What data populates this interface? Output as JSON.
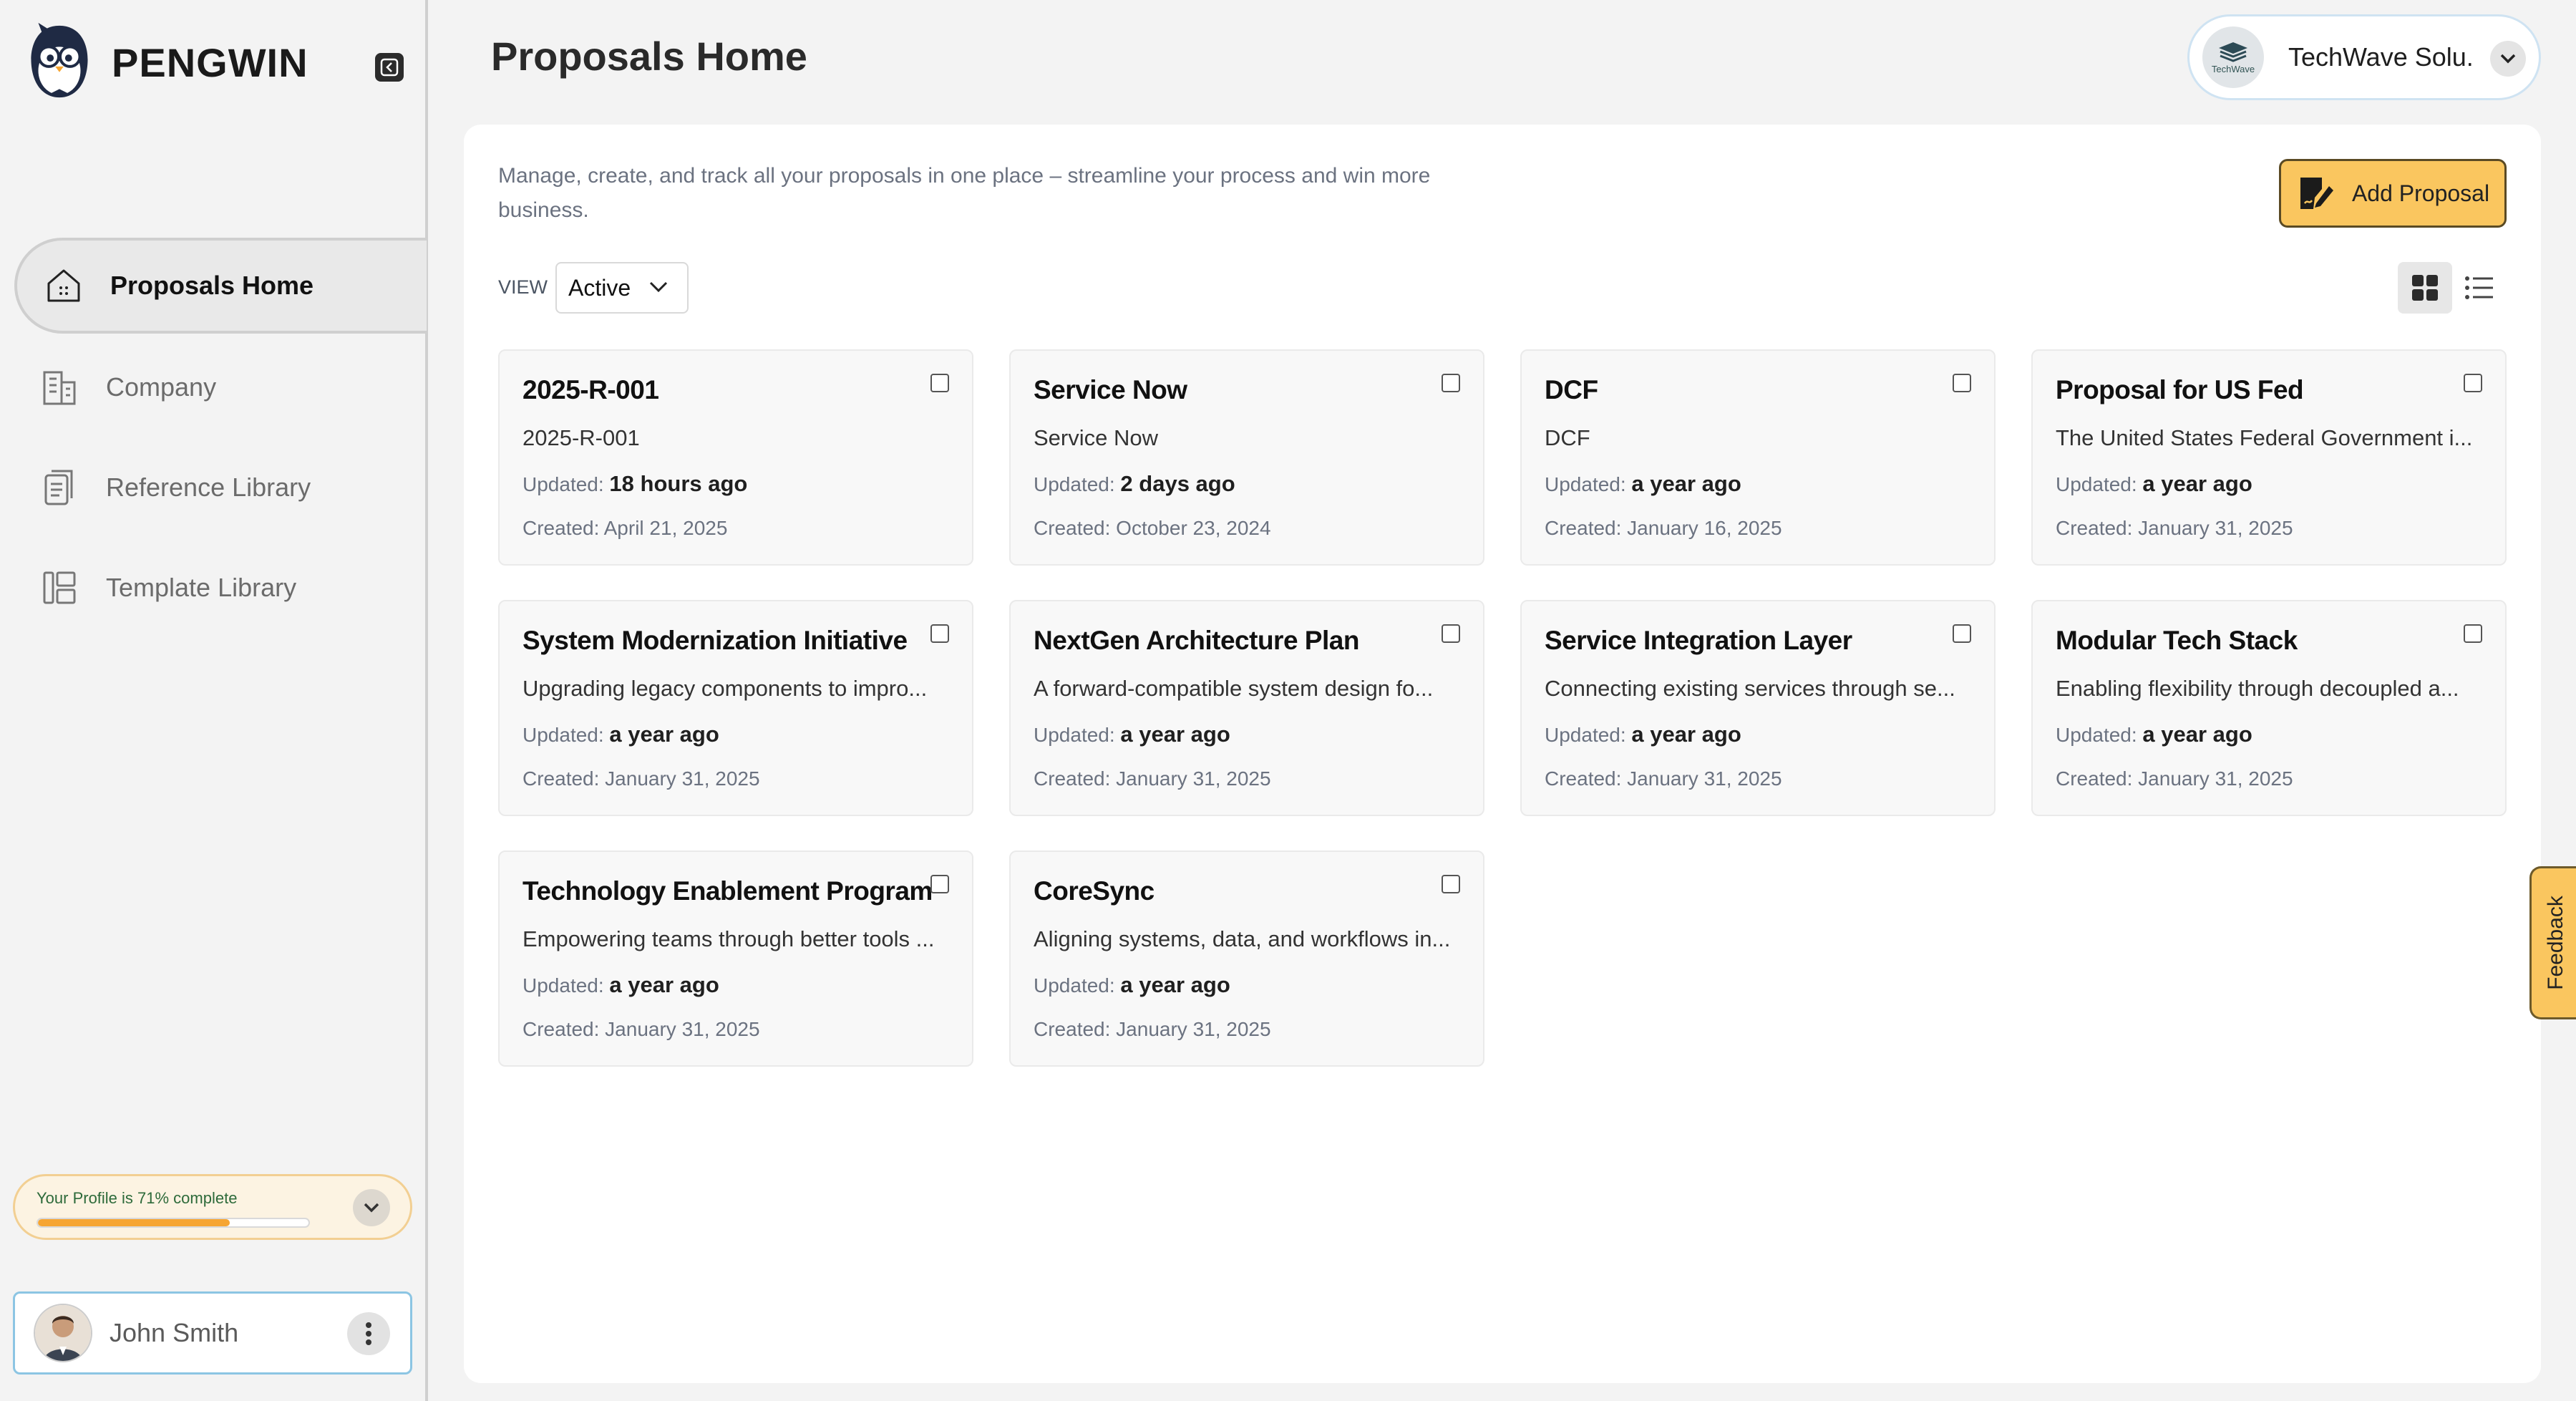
{
  "app": {
    "brand": "PENGWIN"
  },
  "sidebar": {
    "items": [
      {
        "label": "Proposals Home",
        "icon": "home-icon",
        "active": true
      },
      {
        "label": "Company",
        "icon": "building-icon",
        "active": false
      },
      {
        "label": "Reference Library",
        "icon": "documents-icon",
        "active": false
      },
      {
        "label": "Template Library",
        "icon": "template-icon",
        "active": false
      }
    ],
    "profile": {
      "text": "Your Profile is 71% complete",
      "percent": 71
    },
    "user": {
      "name": "John Smith"
    }
  },
  "header": {
    "title": "Proposals Home",
    "org": {
      "name": "TechWave Solu...",
      "logo_text": "TechWave"
    }
  },
  "main": {
    "intro": "Manage, create, and track all your proposals in one place – streamline your process and win more business.",
    "add_button": "Add Proposal",
    "view_label": "VIEW",
    "view_value": "Active",
    "layout_mode": "grid"
  },
  "cards": [
    {
      "title": "2025-R-001",
      "desc": "2025-R-001",
      "updated_label": "Updated:",
      "updated": "18 hours ago",
      "created": "Created: April 21, 2025"
    },
    {
      "title": "Service Now",
      "desc": "Service Now",
      "updated_label": "Updated:",
      "updated": "2 days ago",
      "created": "Created: October 23, 2024"
    },
    {
      "title": "DCF",
      "desc": "DCF",
      "updated_label": "Updated:",
      "updated": "a year ago",
      "created": "Created: January 16, 2025"
    },
    {
      "title": "Proposal for US Fed",
      "desc": "The United States Federal Government i...",
      "updated_label": "Updated:",
      "updated": "a year ago",
      "created": "Created: January 31, 2025"
    },
    {
      "title": "System Modernization Initiative",
      "desc": "Upgrading legacy components to impro...",
      "updated_label": "Updated:",
      "updated": "a year ago",
      "created": "Created: January 31, 2025"
    },
    {
      "title": "NextGen Architecture Plan",
      "desc": "A forward-compatible system design fo...",
      "updated_label": "Updated:",
      "updated": "a year ago",
      "created": "Created: January 31, 2025"
    },
    {
      "title": "Service Integration Layer",
      "desc": "Connecting existing services through se...",
      "updated_label": "Updated:",
      "updated": "a year ago",
      "created": "Created: January 31, 2025"
    },
    {
      "title": "Modular Tech Stack",
      "desc": "Enabling flexibility through decoupled a...",
      "updated_label": "Updated:",
      "updated": "a year ago",
      "created": "Created: January 31, 2025"
    },
    {
      "title": "Technology Enablement Program",
      "desc": "Empowering teams through better tools ...",
      "updated_label": "Updated:",
      "updated": "a year ago",
      "created": "Created: January 31, 2025"
    },
    {
      "title": "CoreSync",
      "desc": "Aligning systems, data, and workflows in...",
      "updated_label": "Updated:",
      "updated": "a year ago",
      "created": "Created: January 31, 2025"
    }
  ],
  "feedback": "Feedback",
  "colors": {
    "accent": "#fac65f",
    "progress": "#f6a531",
    "active_nav_bg": "#e9e9e9"
  }
}
